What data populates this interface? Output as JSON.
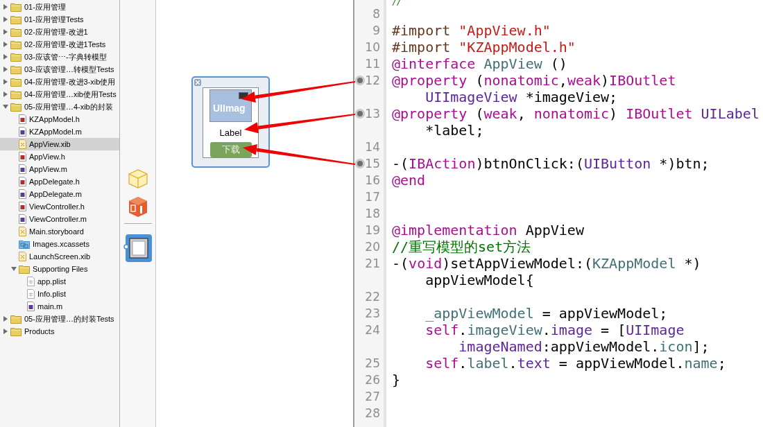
{
  "navigator": {
    "items": [
      {
        "label": "01-应用管理",
        "kind": "folder",
        "expanded": false,
        "selected": false
      },
      {
        "label": "01-应用管理Tests",
        "kind": "folder",
        "expanded": false,
        "selected": false
      },
      {
        "label": "02-应用管理-改进1",
        "kind": "folder",
        "expanded": false,
        "selected": false
      },
      {
        "label": "02-应用管理-改进1Tests",
        "kind": "folder",
        "expanded": false,
        "selected": false
      },
      {
        "label": "03-应该管⋯-字典转模型",
        "kind": "folder",
        "expanded": false,
        "selected": false
      },
      {
        "label": "03-应该管理…转模型Tests",
        "kind": "folder",
        "expanded": false,
        "selected": false
      },
      {
        "label": "04-应用管理-改进3-xib使用",
        "kind": "folder",
        "expanded": false,
        "selected": false
      },
      {
        "label": "04-应用管理…xib使用Tests",
        "kind": "folder",
        "expanded": false,
        "selected": false
      },
      {
        "label": "05-应用管理…4-xib的封装",
        "kind": "folder",
        "expanded": true,
        "selected": false,
        "children": [
          {
            "label": "KZAppModel.h",
            "kind": "header",
            "selected": false
          },
          {
            "label": "KZAppModel.m",
            "kind": "source",
            "selected": false
          },
          {
            "label": "AppView.xib",
            "kind": "xib",
            "selected": true
          },
          {
            "label": "AppView.h",
            "kind": "header",
            "selected": false
          },
          {
            "label": "AppView.m",
            "kind": "source",
            "selected": false
          },
          {
            "label": "AppDelegate.h",
            "kind": "header",
            "selected": false
          },
          {
            "label": "AppDelegate.m",
            "kind": "source",
            "selected": false
          },
          {
            "label": "ViewController.h",
            "kind": "header",
            "selected": false
          },
          {
            "label": "ViewController.m",
            "kind": "source",
            "selected": false
          },
          {
            "label": "Main.storyboard",
            "kind": "xib",
            "selected": false
          },
          {
            "label": "Images.xcassets",
            "kind": "assets",
            "selected": false
          },
          {
            "label": "LaunchScreen.xib",
            "kind": "xib",
            "selected": false
          },
          {
            "label": "Supporting Files",
            "kind": "folder",
            "expanded": true,
            "selected": false,
            "children": [
              {
                "label": "app.plist",
                "kind": "plist",
                "selected": false
              },
              {
                "label": "Info.plist",
                "kind": "plist",
                "selected": false
              },
              {
                "label": "main.m",
                "kind": "source",
                "selected": false
              }
            ]
          }
        ]
      },
      {
        "label": "05-应用管理…的封装Tests",
        "kind": "folder",
        "expanded": false,
        "selected": false
      },
      {
        "label": "Products",
        "kind": "folder",
        "expanded": false,
        "selected": false
      }
    ]
  },
  "dock": {
    "items": [
      {
        "kind": "owner",
        "selected": false
      },
      {
        "kind": "responder",
        "selected": false
      },
      {
        "kind": "view",
        "selected": true
      }
    ]
  },
  "xib_view": {
    "image_view": {
      "text": "UIImag",
      "outlet_arrow": true
    },
    "label": {
      "text": "Label",
      "outlet_arrow": true
    },
    "button": {
      "text": "下载",
      "outlet_arrow": true
    }
  },
  "editor": {
    "lines": [
      {
        "tokens": [
          {
            "kind": "comment",
            "text": "//"
          }
        ]
      },
      {
        "number": "8",
        "connected": false
      },
      {
        "number": "9",
        "connected": false,
        "tokens": [
          {
            "kind": "preproc",
            "text": "#import "
          },
          {
            "kind": "string",
            "text": "\"AppView.h\""
          }
        ]
      },
      {
        "number": "10",
        "connected": false,
        "tokens": [
          {
            "kind": "preproc",
            "text": "#import "
          },
          {
            "kind": "string",
            "text": "\"KZAppModel.h\""
          }
        ]
      },
      {
        "number": "11",
        "connected": false,
        "tokens": [
          {
            "kind": "keyword",
            "text": "@interface"
          },
          {
            "kind": "project",
            "text": " AppView"
          },
          {
            "kind": "plain",
            "text": " ()"
          }
        ]
      },
      {
        "number": "12",
        "connected": true,
        "tokens": [
          {
            "kind": "keyword",
            "text": "@property"
          },
          {
            "kind": "plain",
            "text": " ("
          },
          {
            "kind": "keyword",
            "text": "nonatomic"
          },
          {
            "kind": "plain",
            "text": ","
          },
          {
            "kind": "keyword",
            "text": "weak"
          },
          {
            "kind": "plain",
            "text": ")"
          },
          {
            "kind": "keyword",
            "text": "IBOutlet"
          }
        ]
      },
      {
        "tokens": [
          {
            "kind": "type",
            "text": "    UIImageView"
          },
          {
            "kind": "plain",
            "text": " *imageView;"
          }
        ]
      },
      {
        "number": "13",
        "connected": true,
        "tokens": [
          {
            "kind": "keyword",
            "text": "@property"
          },
          {
            "kind": "plain",
            "text": " ("
          },
          {
            "kind": "keyword",
            "text": "weak"
          },
          {
            "kind": "plain",
            "text": ", "
          },
          {
            "kind": "keyword",
            "text": "nonatomic"
          },
          {
            "kind": "plain",
            "text": ") "
          },
          {
            "kind": "keyword",
            "text": "IBOutlet"
          },
          {
            "kind": "type",
            "text": " UILabel"
          }
        ]
      },
      {
        "tokens": [
          {
            "kind": "plain",
            "text": "    *label;"
          }
        ]
      },
      {
        "number": "14",
        "connected": false
      },
      {
        "number": "15",
        "connected": true,
        "tokens": [
          {
            "kind": "plain",
            "text": "-("
          },
          {
            "kind": "keyword",
            "text": "IBAction"
          },
          {
            "kind": "plain",
            "text": ")btnOnClick:("
          },
          {
            "kind": "type",
            "text": "UIButton"
          },
          {
            "kind": "plain",
            "text": " *)btn;"
          }
        ]
      },
      {
        "number": "16",
        "connected": false,
        "tokens": [
          {
            "kind": "keyword",
            "text": "@end"
          }
        ]
      },
      {
        "number": "17",
        "connected": false
      },
      {
        "number": "18",
        "connected": false
      },
      {
        "number": "19",
        "connected": false,
        "tokens": [
          {
            "kind": "keyword",
            "text": "@implementation"
          },
          {
            "kind": "plain",
            "text": " AppView"
          }
        ]
      },
      {
        "number": "20",
        "connected": false,
        "tokens": [
          {
            "kind": "comment",
            "text": "//重写模型的set方法"
          }
        ]
      },
      {
        "number": "21",
        "connected": false,
        "tokens": [
          {
            "kind": "plain",
            "text": "-("
          },
          {
            "kind": "keyword",
            "text": "void"
          },
          {
            "kind": "plain",
            "text": ")setAppViewModel:("
          },
          {
            "kind": "project",
            "text": "KZAppModel"
          },
          {
            "kind": "plain",
            "text": " *)"
          }
        ]
      },
      {
        "tokens": [
          {
            "kind": "plain",
            "text": "    appViewModel{"
          }
        ]
      },
      {
        "number": "22",
        "connected": false
      },
      {
        "number": "23",
        "connected": false,
        "tokens": [
          {
            "kind": "project",
            "text": "    _appViewModel"
          },
          {
            "kind": "plain",
            "text": " = appViewModel;"
          }
        ]
      },
      {
        "number": "24",
        "connected": false,
        "tokens": [
          {
            "kind": "keyword",
            "text": "    self"
          },
          {
            "kind": "plain",
            "text": "."
          },
          {
            "kind": "project",
            "text": "imageView"
          },
          {
            "kind": "plain",
            "text": "."
          },
          {
            "kind": "type",
            "text": "image"
          },
          {
            "kind": "plain",
            "text": " = ["
          },
          {
            "kind": "type",
            "text": "UIImage"
          }
        ]
      },
      {
        "tokens": [
          {
            "kind": "type",
            "text": "        imageNamed"
          },
          {
            "kind": "plain",
            "text": ":appViewModel."
          },
          {
            "kind": "project",
            "text": "icon"
          },
          {
            "kind": "plain",
            "text": "];"
          }
        ]
      },
      {
        "number": "25",
        "connected": false,
        "tokens": [
          {
            "kind": "keyword",
            "text": "    self"
          },
          {
            "kind": "plain",
            "text": "."
          },
          {
            "kind": "project",
            "text": "label"
          },
          {
            "kind": "plain",
            "text": "."
          },
          {
            "kind": "type",
            "text": "text"
          },
          {
            "kind": "plain",
            "text": " = appViewModel."
          },
          {
            "kind": "project",
            "text": "name"
          },
          {
            "kind": "plain",
            "text": ";"
          }
        ]
      },
      {
        "number": "26",
        "connected": false,
        "tokens": [
          {
            "kind": "plain",
            "text": "}"
          }
        ]
      },
      {
        "number": "27",
        "connected": false
      },
      {
        "number": "28",
        "connected": false
      }
    ]
  }
}
